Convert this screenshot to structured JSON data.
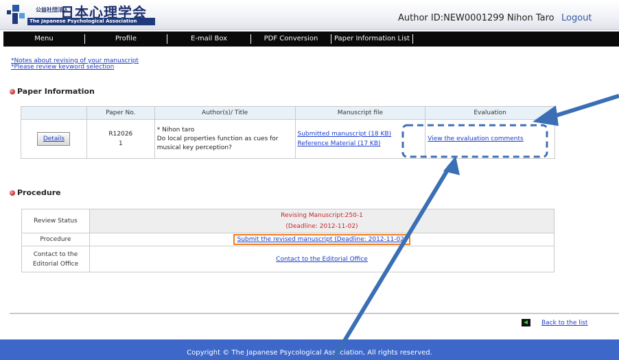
{
  "header": {
    "org_small": "公益社団法人",
    "org_name": "日本心理学会",
    "org_en": "The Japanese Psychological Association",
    "user_info": "Author  ID:NEW0001299 Nihon Taro",
    "logout": "Logout"
  },
  "nav": [
    "Menu",
    "Profile",
    "E-mail Box",
    "PDF Conversion",
    "Paper Information List"
  ],
  "notes": [
    "*Notes about revising of your manuscript",
    "*Please review keyword selection"
  ],
  "paper_section": {
    "title": "Paper Information",
    "headers": [
      "Paper No.",
      "Author(s)/ Title",
      "Manuscript file",
      "Evaluation"
    ],
    "row": {
      "details": "Details",
      "paper_no": "R12026\n1",
      "author": "* Nihon taro",
      "title": "Do local properties function as cues for musical key perception?",
      "files": [
        "Submitted manuscript (18 KB)",
        "Reference Material (17 KB)"
      ],
      "evaluation": "View the evaluation comments"
    }
  },
  "procedure_section": {
    "title": "Procedure",
    "review_status_label": "Review Status",
    "review_status_line1": "Revising Manuscript:250-1",
    "review_status_line2": "(Deadline: 2012-11-02)",
    "procedure_label": "Procedure",
    "procedure_link": "Submit the revised manuscript (Deadline: 2012-11-02)",
    "contact_label": "Contact to the Editorial Office",
    "contact_link": "Contact to the Editorial Office"
  },
  "back_link": "Back to the list",
  "footer": "Copyright © The Japanese Psycological Association, All rights reserved.",
  "colors": {
    "nav_bg": "#0a0a0a",
    "footer_bg": "#3d68c9",
    "accent_arrow": "#3b6fb5",
    "status_red": "#c4262b"
  }
}
